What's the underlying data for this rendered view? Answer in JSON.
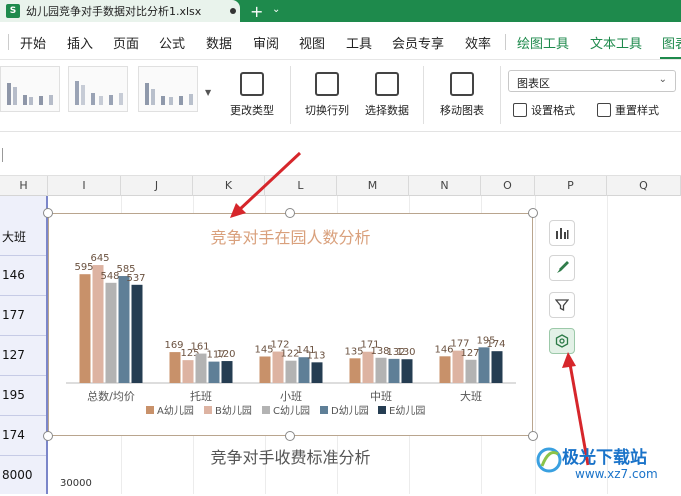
{
  "titlebar": {
    "doc_icon": "S",
    "doc_name": "幼儿园竞争对手数据对比分析1.xlsx",
    "new_tab": "+",
    "new_tab_menu": "⌄"
  },
  "menu": {
    "items": [
      "开始",
      "插入",
      "页面",
      "公式",
      "数据",
      "审阅",
      "视图",
      "工具",
      "会员专享",
      "效率",
      "绘图工具",
      "文本工具",
      "图表"
    ]
  },
  "ribbon": {
    "change_type": "更改类型",
    "switch_rowcol": "切换行列",
    "select_data": "选择数据",
    "move_chart": "移动图表",
    "chart_area_select": "图表区",
    "set_format": "设置格式",
    "reset_style": "重置样式"
  },
  "columns": [
    "H",
    "I",
    "J",
    "K",
    "L",
    "M",
    "N",
    "O",
    "P",
    "Q"
  ],
  "cells": [
    "大班",
    "146",
    "177",
    "127",
    "195",
    "174",
    "8000"
  ],
  "chart_data": {
    "type": "bar",
    "title": "竞争对手在园人数分析",
    "categories": [
      "总数/均价",
      "托班",
      "小班",
      "中班",
      "大班"
    ],
    "series": [
      {
        "name": "A幼儿园",
        "color": "#c8916a",
        "values": [
          595,
          169,
          145,
          135,
          146
        ]
      },
      {
        "name": "B幼儿园",
        "color": "#ddb3a2",
        "values": [
          645,
          125,
          172,
          171,
          177
        ]
      },
      {
        "name": "C幼儿园",
        "color": "#b3b3b3",
        "values": [
          548,
          161,
          122,
          138,
          127
        ]
      },
      {
        "name": "D幼儿园",
        "color": "#5f7f97",
        "values": [
          585,
          117,
          141,
          132,
          195
        ]
      },
      {
        "name": "E幼儿园",
        "color": "#253d52",
        "values": [
          537,
          120,
          113,
          130,
          174
        ]
      }
    ],
    "ylim": [
      0,
      700
    ],
    "legend": "bottom"
  },
  "chart2": {
    "title": "竞争对手收费标准分析",
    "tick": "30000"
  },
  "watermark": {
    "name": "极光下载站",
    "url": "www.xz7.com"
  },
  "colors": {
    "accent": "#1e8a4c",
    "arrow": "#d6262b"
  }
}
